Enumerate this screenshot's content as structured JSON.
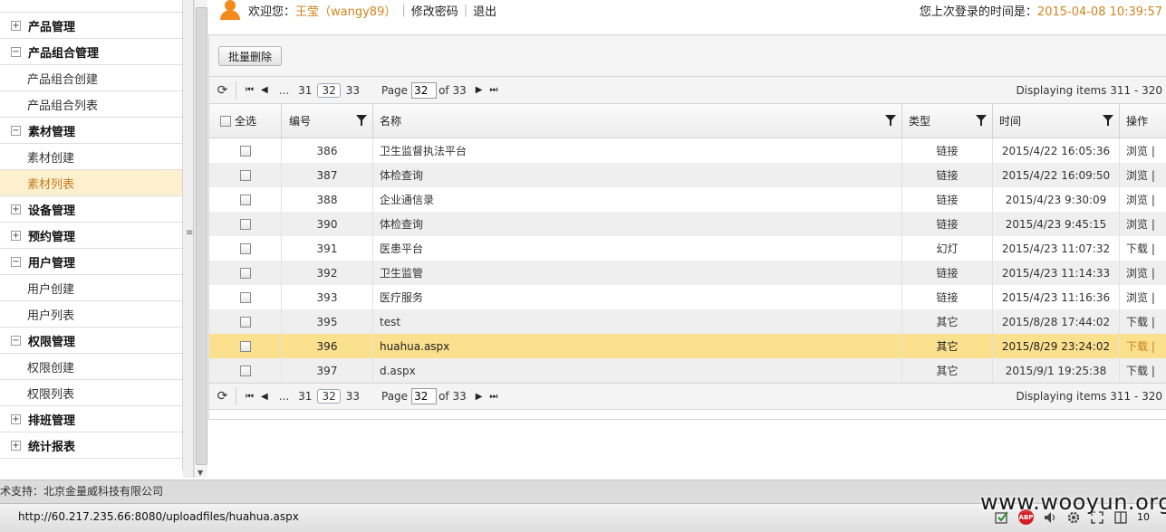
{
  "sidebar": {
    "groups": [
      {
        "label": "产品管理",
        "toggle": "+",
        "children": []
      },
      {
        "label": "产品组合管理",
        "toggle": "−",
        "children": [
          "产品组合创建",
          "产品组合列表"
        ]
      },
      {
        "label": "素材管理",
        "toggle": "−",
        "children": [
          "素材创建",
          "素材列表"
        ]
      },
      {
        "label": "设备管理",
        "toggle": "+",
        "children": []
      },
      {
        "label": "预约管理",
        "toggle": "+",
        "children": []
      },
      {
        "label": "用户管理",
        "toggle": "−",
        "children": [
          "用户创建",
          "用户列表"
        ]
      },
      {
        "label": "权限管理",
        "toggle": "−",
        "children": [
          "权限创建",
          "权限列表"
        ]
      },
      {
        "label": "排班管理",
        "toggle": "+",
        "children": []
      },
      {
        "label": "统计报表",
        "toggle": "+",
        "children": []
      }
    ],
    "active_item": "素材列表"
  },
  "header": {
    "welcome": "欢迎您：",
    "user": "王莹（wangy89）",
    "change_password": "修改密码",
    "logout": "退出",
    "last_login_label": "您上次登录的时间是：",
    "last_login_time": "2015-04-08 10:39:57"
  },
  "toolbar": {
    "batch_delete": "批量删除"
  },
  "pager": {
    "ellipsis": "...",
    "pages": [
      "31",
      "32",
      "33"
    ],
    "current_page": "32",
    "page_label": "Page",
    "page_value": "32",
    "of_label": "of 33",
    "display": "Displaying items 311 - 320"
  },
  "table": {
    "headers": {
      "select_all": "全选",
      "id": "编号",
      "name": "名称",
      "type": "类型",
      "time": "时间",
      "action": "操作"
    },
    "rows": [
      {
        "id": "386",
        "name": "卫生监督执法平台",
        "type": "链接",
        "time": "2015/4/22 16:05:36",
        "action": "浏览 |"
      },
      {
        "id": "387",
        "name": "体检查询",
        "type": "链接",
        "time": "2015/4/22 16:09:50",
        "action": "浏览 |"
      },
      {
        "id": "388",
        "name": "企业通信录",
        "type": "链接",
        "time": "2015/4/23 9:30:09",
        "action": "浏览 |"
      },
      {
        "id": "390",
        "name": "体检查询",
        "type": "链接",
        "time": "2015/4/23 9:45:15",
        "action": "浏览 |"
      },
      {
        "id": "391",
        "name": "医患平台",
        "type": "幻灯",
        "time": "2015/4/23 11:07:32",
        "action": "下载 |"
      },
      {
        "id": "392",
        "name": "卫生监管",
        "type": "链接",
        "time": "2015/4/23 11:14:33",
        "action": "浏览 |"
      },
      {
        "id": "393",
        "name": "医疗服务",
        "type": "链接",
        "time": "2015/4/23 11:16:36",
        "action": "浏览 |"
      },
      {
        "id": "395",
        "name": "test",
        "type": "其它",
        "time": "2015/8/28 17:44:02",
        "action": "下载 |"
      },
      {
        "id": "396",
        "name": "huahua.aspx",
        "type": "其它",
        "time": "2015/8/29 23:24:02",
        "action": "下载 |"
      },
      {
        "id": "397",
        "name": "d.aspx",
        "type": "其它",
        "time": "2015/9/1 19:25:38",
        "action": "下载 |"
      }
    ],
    "selected_row_id": "396"
  },
  "footer": {
    "support": "术支持：北京金量威科技有限公司"
  },
  "statusbar": {
    "url": "http://60.217.235.66:8080/uploadfiles/huahua.aspx",
    "abp_label": "ABP",
    "zoom": "10"
  },
  "watermark": "www.wooyun.org",
  "colors": {
    "accent_orange": "#d2841f",
    "selected_row": "#fbe08d",
    "active_nav": "#fdf0cf"
  }
}
